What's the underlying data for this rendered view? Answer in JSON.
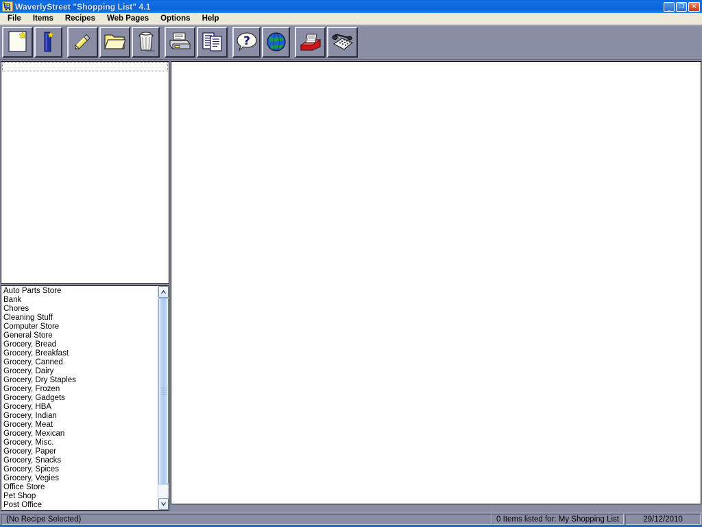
{
  "window": {
    "title": "WaverlyStreet \"Shopping List\" 4.1",
    "icon": "shopping-cart-icon",
    "controls": {
      "minimize": "_",
      "restore": "❐",
      "close": "✕"
    }
  },
  "menubar": {
    "items": [
      {
        "label": "File"
      },
      {
        "label": "Items"
      },
      {
        "label": "Recipes"
      },
      {
        "label": "Web Pages"
      },
      {
        "label": "Options"
      },
      {
        "label": "Help"
      }
    ]
  },
  "toolbar": {
    "buttons": [
      {
        "name": "new-list-button",
        "icon": "new-document-icon",
        "title": "New List"
      },
      {
        "name": "new-item-button",
        "icon": "new-item-icon",
        "title": "New Item"
      },
      {
        "name": "edit-button",
        "icon": "pencil-icon",
        "title": "Edit"
      },
      {
        "name": "open-button",
        "icon": "open-folder-icon",
        "title": "Open"
      },
      {
        "name": "delete-button",
        "icon": "trash-can-icon",
        "title": "Delete"
      },
      {
        "name": "print-button",
        "icon": "printer-icon",
        "title": "Print"
      },
      {
        "name": "copy-button",
        "icon": "copy-pages-icon",
        "title": "Copy"
      },
      {
        "name": "help-button",
        "icon": "question-balloon-icon",
        "title": "Help"
      },
      {
        "name": "web-button",
        "icon": "globe-icon",
        "title": "Web Pages"
      },
      {
        "name": "recipes-button",
        "icon": "card-file-icon",
        "title": "Recipes"
      },
      {
        "name": "phone-button",
        "icon": "telephone-icon",
        "title": "Phone"
      }
    ]
  },
  "categories": {
    "items": [
      "Auto Parts Store",
      "Bank",
      "Chores",
      "Cleaning Stuff",
      "Computer Store",
      "General Store",
      "Grocery, Bread",
      "Grocery, Breakfast",
      "Grocery, Canned",
      "Grocery, Dairy",
      "Grocery, Dry Staples",
      "Grocery, Frozen",
      "Grocery, Gadgets",
      "Grocery, HBA",
      "Grocery, Indian",
      "Grocery, Meat",
      "Grocery, Mexican",
      "Grocery, Misc.",
      "Grocery, Paper",
      "Grocery, Snacks",
      "Grocery, Spices",
      "Grocery, Vegies",
      "Office Store",
      "Pet Shop",
      "Post Office"
    ]
  },
  "items_panel": {
    "items": []
  },
  "main_panel": {
    "content": ""
  },
  "statusbar": {
    "recipe": "(No Recipe Selected)",
    "items_count": "0 Items listed for: My Shopping List",
    "date": "29/12/2010"
  },
  "colors": {
    "titlebar_blue": "#0e6ae0",
    "toolbar_gray": "#8a8ea4",
    "menubar": "#ece9d8",
    "panel_white": "#ffffff",
    "scrollbar_thumb": "#aec9ee"
  }
}
